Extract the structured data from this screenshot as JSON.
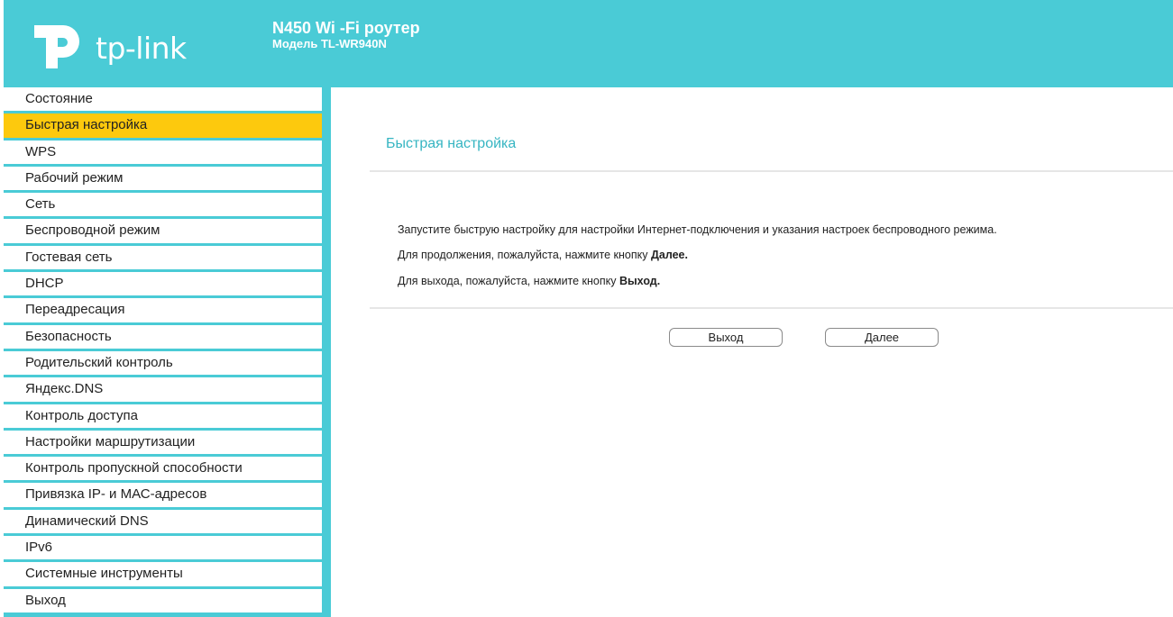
{
  "header": {
    "logo_text": "tp-link",
    "title": "N450 Wi -Fi роутер",
    "model": "Модель TL-WR940N"
  },
  "colors": {
    "accent": "#4acbd6",
    "active_menu": "#fdc90d",
    "title_text": "#36b5c2"
  },
  "sidebar": {
    "items": [
      {
        "label": "Состояние"
      },
      {
        "label": "Быстрая настройка",
        "active": true
      },
      {
        "label": "WPS"
      },
      {
        "label": "Рабочий режим"
      },
      {
        "label": "Сеть"
      },
      {
        "label": "Беспроводной режим"
      },
      {
        "label": "Гостевая сеть"
      },
      {
        "label": "DHCP"
      },
      {
        "label": "Переадресация"
      },
      {
        "label": "Безопасность"
      },
      {
        "label": "Родительский контроль"
      },
      {
        "label": "Яндекс.DNS"
      },
      {
        "label": "Контроль доступа"
      },
      {
        "label": "Настройки маршрутизации"
      },
      {
        "label": "Контроль пропускной способности"
      },
      {
        "label": "Привязка IP- и МАС-адресов"
      },
      {
        "label": "Динамический DNS"
      },
      {
        "label": "IPv6"
      },
      {
        "label": "Системные инструменты"
      },
      {
        "label": "Выход"
      }
    ]
  },
  "main": {
    "title": "Быстрая настройка",
    "line1": "Запустите быструю настройку для настройки Интернет-подключения и указания настроек беспроводного режима.",
    "line2_prefix": "Для продолжения, пожалуйста, нажмите кнопку ",
    "line2_bold": "Далее.",
    "line3_prefix": "Для выхода, пожалуйста, нажмите кнопку ",
    "line3_bold": "Выход.",
    "exit_button": "Выход",
    "next_button": "Далее"
  }
}
